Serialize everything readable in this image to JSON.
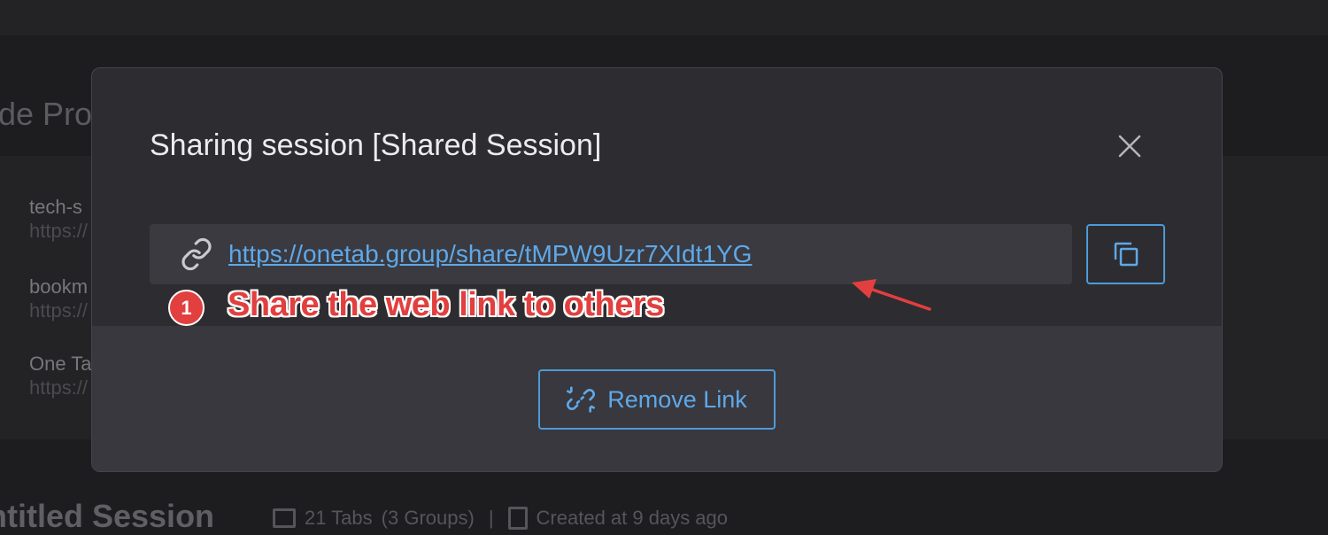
{
  "background": {
    "heading": "de Pro",
    "items": [
      {
        "title": "tech-s",
        "url": "https://"
      },
      {
        "title": "bookm",
        "url": "https://"
      },
      {
        "title": "One Ta",
        "url": "https://"
      }
    ],
    "session_title": "ntitled Session",
    "session_meta": {
      "tabs": "21 Tabs",
      "groups": "(3 Groups)",
      "separator": "|",
      "created": "Created at 9 days ago"
    }
  },
  "modal": {
    "title": "Sharing session [Shared Session]",
    "share_link": "https://onetab.group/share/tMPW9Uzr7XIdt1YG",
    "remove_link_label": "Remove Link",
    "icons": {
      "close": "close-icon",
      "link": "link-icon",
      "copy": "copy-icon",
      "unlink": "unlink-icon"
    }
  },
  "annotation": {
    "badge": "1",
    "text": "Share the web link to others",
    "color": "#e23f3f"
  },
  "colors": {
    "accent": "#5fa8e8",
    "modal_bg": "#2d2d31",
    "page_bg": "#1d1d20"
  }
}
